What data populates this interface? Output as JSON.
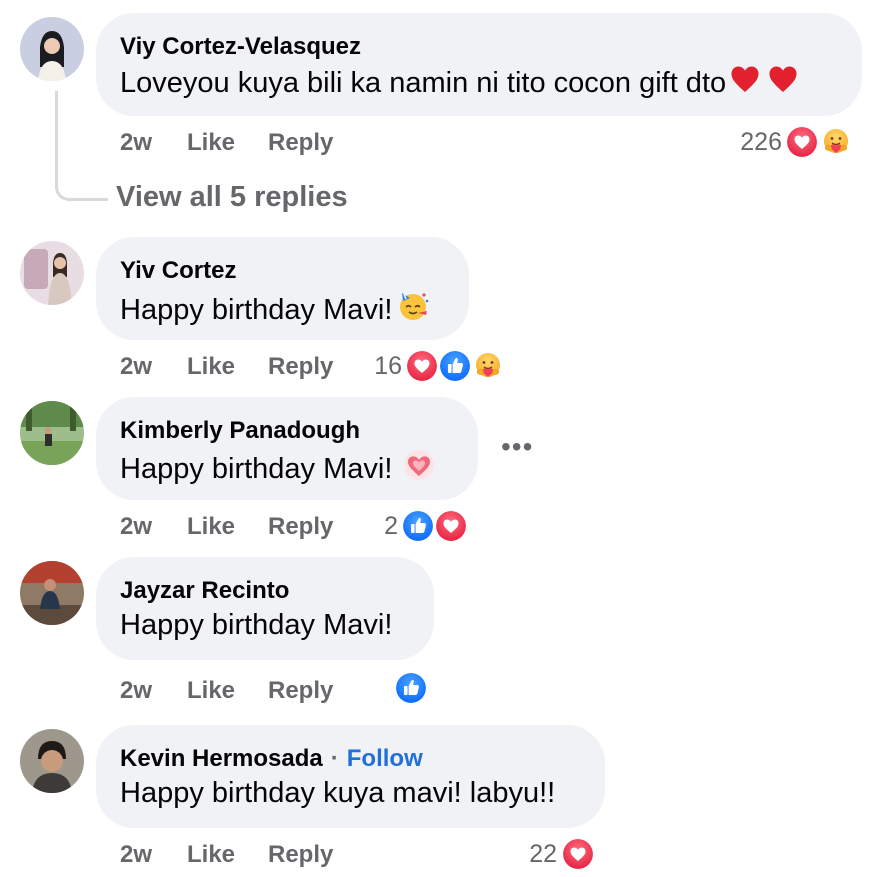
{
  "comments": [
    {
      "author": "Viy Cortez-Velasquez",
      "text": "Loveyou kuya bili ka namin ni tito cocon gift dto",
      "inline_emojis": [
        "heart-emoji",
        "heart-emoji"
      ],
      "time": "2w",
      "like_label": "Like",
      "reply_label": "Reply",
      "reaction_count": "226",
      "reactions": [
        "love-reaction",
        "care-reaction"
      ],
      "view_replies_label": "View all 5 replies"
    },
    {
      "author": "Yiv Cortez",
      "text": "Happy birthday Mavi!",
      "inline_emojis": [
        "partying-face-emoji"
      ],
      "time": "2w",
      "like_label": "Like",
      "reply_label": "Reply",
      "reaction_count": "16",
      "reactions": [
        "love-reaction",
        "like-reaction",
        "care-reaction"
      ]
    },
    {
      "author": "Kimberly Panadough",
      "text": "Happy birthday Mavi!",
      "inline_emojis": [
        "sparkling-heart-emoji"
      ],
      "time": "2w",
      "like_label": "Like",
      "reply_label": "Reply",
      "reaction_count": "2",
      "reactions": [
        "like-reaction",
        "love-reaction"
      ],
      "more_label": "•••"
    },
    {
      "author": "Jayzar Recinto",
      "text": "Happy birthday Mavi!",
      "time": "2w",
      "like_label": "Like",
      "reply_label": "Reply",
      "reaction_count": "",
      "reactions": [
        "like-reaction"
      ]
    },
    {
      "author": "Kevin Hermosada",
      "follow_label": "Follow",
      "text": "Happy birthday kuya mavi! labyu!!",
      "time": "2w",
      "like_label": "Like",
      "reply_label": "Reply",
      "reaction_count": "22",
      "reactions": [
        "love-reaction"
      ]
    }
  ],
  "colors": {
    "bubble": "#f0f2f5",
    "meta": "#65676b",
    "follow": "#216fdb",
    "like_blue": "#1b74e4",
    "love_red": "#f33e58",
    "care_yellow": "#f7b125"
  }
}
